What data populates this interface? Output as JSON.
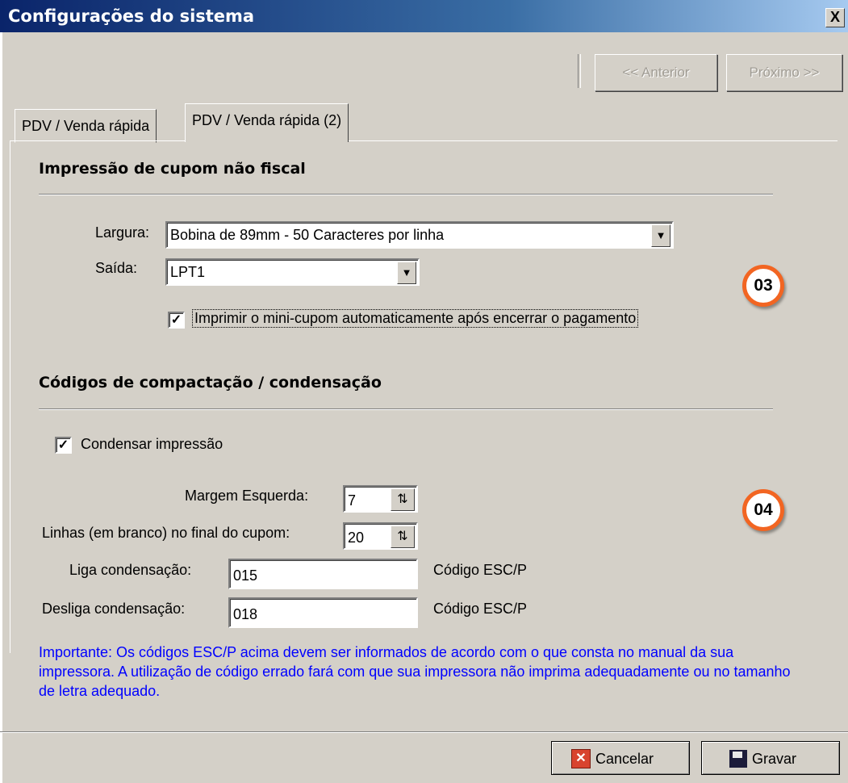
{
  "window": {
    "title": "Configurações do sistema",
    "close_label": "X"
  },
  "toolbar": {
    "prev_label": "<< Anterior",
    "next_label": "Próximo >>"
  },
  "tabs": [
    {
      "label": "PDV / Venda rápida",
      "active": false
    },
    {
      "label": "PDV / Venda rápida (2)",
      "active": true
    }
  ],
  "print_section": {
    "title": "Impressão de cupom não fiscal",
    "width_label": "Largura:",
    "width_value": "Bobina de 89mm - 50 Caracteres por linha",
    "output_label": "Saída:",
    "output_value": "LPT1",
    "auto_print_label": "Imprimir o mini-cupom automaticamente após encerrar o pagamento",
    "auto_print_checked": true,
    "badge": "03"
  },
  "codes_section": {
    "title": "Códigos de compactação / condensação",
    "condense_label": "Condensar impressão",
    "condense_checked": true,
    "left_margin_label": "Margem Esquerda:",
    "left_margin_value": "7",
    "blank_lines_label": "Linhas (em branco) no final do cupom:",
    "blank_lines_value": "20",
    "enable_label": "Liga condensação:",
    "enable_value": "015",
    "enable_hint": "Código ESC/P",
    "disable_label": "Desliga condensação:",
    "disable_value": "018",
    "disable_hint": "Código ESC/P",
    "badge": "04"
  },
  "info_text": "Importante: Os códigos ESC/P acima devem ser informados de acordo com o que consta no manual da sua impressora. A utilização de código errado fará com que sua impressora não imprima adequadamente ou no tamanho de letra adequado.",
  "footer": {
    "cancel_label": "Cancelar",
    "save_label": "Gravar"
  },
  "colors": {
    "accent_badge": "#f26522",
    "info_text": "#0000ff",
    "titlebar": "#0a246a"
  },
  "icons": {
    "cancel": "cancel-x-icon",
    "save": "floppy-disk-icon",
    "dropdown": "chevron-down-icon",
    "spin": "spin-arrows-icon",
    "check": "check-icon"
  }
}
